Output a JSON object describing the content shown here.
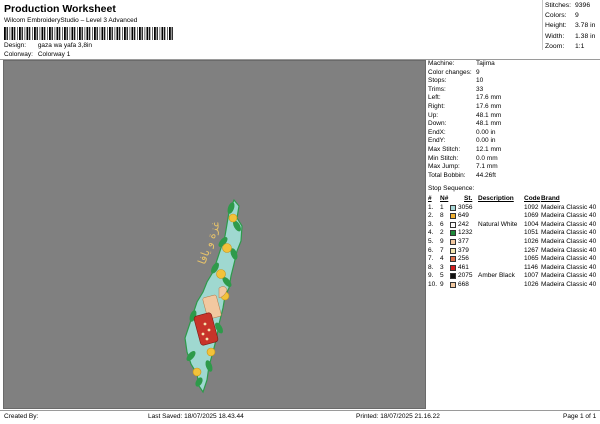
{
  "header": {
    "title": "Production Worksheet",
    "subtitle": "Wilcom EmbroideryStudio – Level 3 Advanced",
    "design_label": "Design:",
    "design_value": "gaza wa yafa 3,8in",
    "colorway_label": "Colorway:",
    "colorway_value": "Colorway 1"
  },
  "stats_top": [
    {
      "label": "Stitches:",
      "value": "9396"
    },
    {
      "label": "Colors:",
      "value": "9"
    },
    {
      "label": "Height:",
      "value": "3.78 in"
    },
    {
      "label": "Width:",
      "value": "1.38 in"
    },
    {
      "label": "Zoom:",
      "value": "1:1"
    }
  ],
  "machine_info": [
    {
      "label": "Machine:",
      "value": "Tajima"
    },
    {
      "label": "Color changes:",
      "value": "9"
    },
    {
      "label": "Stops:",
      "value": "10"
    },
    {
      "label": "Trims:",
      "value": "33"
    },
    {
      "label": "Left:",
      "value": "17.6 mm"
    },
    {
      "label": "Right:",
      "value": "17.6 mm"
    },
    {
      "label": "Up:",
      "value": "48.1 mm"
    },
    {
      "label": "Down:",
      "value": "48.1 mm"
    },
    {
      "label": "EndX:",
      "value": "0.00 in"
    },
    {
      "label": "EndY:",
      "value": "0.00 in"
    },
    {
      "label": "Max Stitch:",
      "value": "12.1 mm"
    },
    {
      "label": "Min Stitch:",
      "value": "0.0 mm"
    },
    {
      "label": "Max Jump:",
      "value": "7.1 mm"
    },
    {
      "label": "Total Bobbin:",
      "value": "44.26ft"
    }
  ],
  "stop_sequence": {
    "title": "Stop Sequence:",
    "headers": {
      "num": "#",
      "n": "N#",
      "st": "St.",
      "desc": "Description",
      "code": "Code",
      "brand": "Brand"
    },
    "rows": [
      {
        "num": "1.",
        "n": "1",
        "color": "#a8d8d8",
        "st": "3056",
        "desc": "",
        "code": "1092",
        "brand": "Madeira Classic 40"
      },
      {
        "num": "2.",
        "n": "8",
        "color": "#f0b030",
        "st": "649",
        "desc": "",
        "code": "1069",
        "brand": "Madeira Classic 40"
      },
      {
        "num": "3.",
        "n": "6",
        "color": "#fafafa",
        "st": "242",
        "desc": "Natural White",
        "code": "1004",
        "brand": "Madeira Classic 40"
      },
      {
        "num": "4.",
        "n": "2",
        "color": "#1e8a3a",
        "st": "1232",
        "desc": "",
        "code": "1051",
        "brand": "Madeira Classic 40"
      },
      {
        "num": "5.",
        "n": "9",
        "color": "#f2c8a0",
        "st": "377",
        "desc": "",
        "code": "1026",
        "brand": "Madeira Classic 40"
      },
      {
        "num": "6.",
        "n": "7",
        "color": "#f5e6b0",
        "st": "379",
        "desc": "",
        "code": "1267",
        "brand": "Madeira Classic 40"
      },
      {
        "num": "7.",
        "n": "4",
        "color": "#e0704a",
        "st": "256",
        "desc": "",
        "code": "1065",
        "brand": "Madeira Classic 40"
      },
      {
        "num": "8.",
        "n": "3",
        "color": "#d01c1c",
        "st": "461",
        "desc": "",
        "code": "1146",
        "brand": "Madeira Classic 40"
      },
      {
        "num": "9.",
        "n": "5",
        "color": "#111111",
        "st": "2075",
        "desc": "Amber Black",
        "code": "1007",
        "brand": "Madeira Classic 40"
      },
      {
        "num": "10.",
        "n": "9",
        "color": "#f2c8a0",
        "st": "668",
        "desc": "",
        "code": "1026",
        "brand": "Madeira Classic 40"
      }
    ]
  },
  "footer": {
    "created_by": "Created By:",
    "last_saved": "Last Saved: 18/07/2025 18.43.44",
    "printed": "Printed: 18/07/2025 21.16.22",
    "page": "Page 1 of 1"
  },
  "design_art": {
    "arabic_text": "غزة و يافا",
    "colors": {
      "fill": "#9fd8d0",
      "leaf": "#2e9a4a",
      "fruit": "#f2c23a",
      "red": "#c8342a",
      "text": "#e7c36a"
    }
  }
}
